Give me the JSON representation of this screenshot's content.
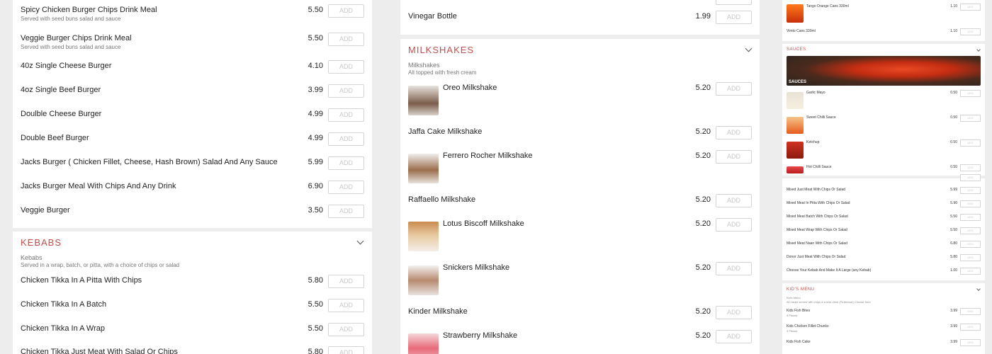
{
  "left": {
    "burgers": [
      {
        "name": "Spicy Chicken Burger Chips Drink Meal",
        "desc": "Served with seed buns salad and sauce",
        "price": "5.50"
      },
      {
        "name": "Veggie Burger Chips Drink Meal",
        "desc": "Served with seed buns salad and sauce",
        "price": "5.50"
      },
      {
        "name": "40z Single Cheese Burger",
        "desc": "",
        "price": "4.10"
      },
      {
        "name": "4oz Single Beef Burger",
        "desc": "",
        "price": "3.99"
      },
      {
        "name": "Doulble Cheese Burger",
        "desc": "",
        "price": "4.99"
      },
      {
        "name": "Double Beef Burger",
        "desc": "",
        "price": "4.99"
      },
      {
        "name": "Jacks Burger ( Chicken Fillet, Cheese, Hash Brown) Salad And Any Sauce",
        "desc": "",
        "price": "5.99"
      },
      {
        "name": "Jacks Burger Meal With Chips And Any Drink",
        "desc": "",
        "price": "6.90"
      },
      {
        "name": "Veggie Burger",
        "desc": "",
        "price": "3.50"
      }
    ],
    "kebabs": {
      "title": "KEBABS",
      "subtitle": "Kebabs",
      "desc": "Served in a wrap, batch, or pitta, with a choice of chips or salad",
      "items": [
        {
          "name": "Chicken Tikka In A Pitta With Chips",
          "price": "5.80"
        },
        {
          "name": "Chicken Tikka In A Batch",
          "price": "5.50"
        },
        {
          "name": "Chicken Tikka In A Wrap",
          "price": "5.50"
        },
        {
          "name": "Chicken Tikka Just Meat With Salad Or Chips",
          "price": "5.80"
        }
      ]
    }
  },
  "middle": {
    "top_item": {
      "name": "Vinegar Bottle",
      "price": "1.99"
    },
    "milkshakes": {
      "title": "MILKSHAKES",
      "subtitle": "Milkshakes",
      "desc": "All topped with fresh cream",
      "items": [
        {
          "name": "Oreo Milkshake",
          "price": "5.20",
          "thumb": true
        },
        {
          "name": "Jaffa Cake Milkshake",
          "price": "5.20",
          "thumb": false
        },
        {
          "name": "Ferrero Rocher Milkshake",
          "price": "5.20",
          "thumb": true
        },
        {
          "name": "Raffaello Milkshake",
          "price": "5.20",
          "thumb": false
        },
        {
          "name": "Lotus Biscoff Milkshake",
          "price": "5.20",
          "thumb": true
        },
        {
          "name": "Snickers Milkshake",
          "price": "5.20",
          "thumb": true
        },
        {
          "name": "Kinder Milkshake",
          "price": "5.20",
          "thumb": false
        },
        {
          "name": "Strawberry Milkshake",
          "price": "5.20",
          "thumb": true
        }
      ]
    }
  },
  "right": {
    "drinks": [
      {
        "name": "Tango Orange Cans 330ml",
        "price": "1.10"
      },
      {
        "name": "Vimto Cans 330ml",
        "price": "1.10"
      }
    ],
    "sauces": {
      "title": "SAUCES",
      "banner_label": "SAUCES",
      "items": [
        {
          "name": "Garlic Mayo",
          "price": "0.50"
        },
        {
          "name": "Sweet Chilli Sauce",
          "price": "0.50"
        },
        {
          "name": "Ketchup",
          "price": "0.50"
        },
        {
          "name": "Hot Chilli Sauce",
          "price": "0.50"
        }
      ]
    },
    "mixed": [
      {
        "name": "Mixed Just Meat With Chips Or Salad",
        "price": "5.99"
      },
      {
        "name": "Mixed Meat In Pitta With Chips Or Salad",
        "price": "5.90"
      },
      {
        "name": "Mixed Meat Batch With Chips Or Salad",
        "price": "5.50"
      },
      {
        "name": "Mixed Meat Wrap With Chips Or Salad",
        "price": "5.50"
      },
      {
        "name": "Mixed Meat Naan With Chips Or Salad",
        "price": "6.80"
      },
      {
        "name": "Donor Just Meat With Chips Or Salad",
        "price": "5.80"
      },
      {
        "name": "Choose Your Kebab And Make It A Large (any Kebab)",
        "price": "1.00"
      }
    ],
    "kids": {
      "title": "KID'S MENU",
      "subtitle": "Kid's Menu",
      "desc": "All meals served with chips & a kids drink (Fruitshoot) Choose from",
      "items": [
        {
          "name": "Kids Fish Bites",
          "desc": "3 Pieces",
          "price": "3.99"
        },
        {
          "name": "Kids Chicken Fillet Chunks",
          "desc": "3 Pieces",
          "price": "3.99"
        },
        {
          "name": "Kids Fish Cake",
          "desc": "",
          "price": "3.99"
        }
      ]
    }
  },
  "add_label": "ADD",
  "colors": {
    "accent": "#c0504d",
    "background": "#ededed",
    "card": "#ffffff"
  }
}
